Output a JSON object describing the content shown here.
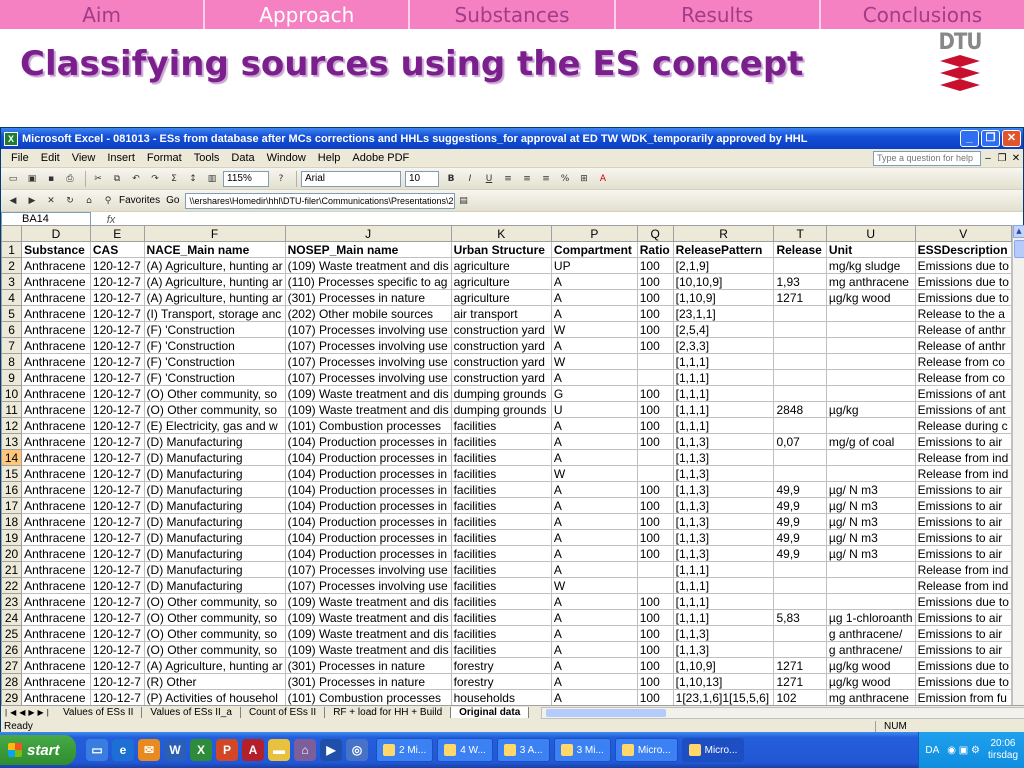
{
  "slide": {
    "nav": [
      {
        "label": "Aim",
        "active": false
      },
      {
        "label": "Approach",
        "active": true
      },
      {
        "label": "Substances",
        "active": false
      },
      {
        "label": "Results",
        "active": false
      },
      {
        "label": "Conclusions",
        "active": false
      }
    ],
    "title": "Classifying sources using the ES concept",
    "logo_text": "DTU"
  },
  "excel": {
    "window_title": "Microsoft Excel - 081013 - ESs from database after MCs corrections and HHLs suggestions_for approval at ED TW WDK_temporarily approved by HHL",
    "menu": [
      "File",
      "Edit",
      "View",
      "Insert",
      "Format",
      "Tools",
      "Data",
      "Window",
      "Help",
      "Adobe PDF"
    ],
    "help_placeholder": "Type a question for help",
    "zoom": "115%",
    "font_name": "Arial",
    "font_size": "10",
    "favorites_label": "Favorites",
    "go_label": "Go",
    "address": "\\\\ershares\\Homedir\\hhl\\DTU-filer\\Communications\\Presentations\\20",
    "name_box": "BA14",
    "fx_label": "fx",
    "column_letters": [
      "D",
      "E",
      "F",
      "J",
      "K",
      "P",
      "Q",
      "R",
      "T",
      "U",
      "V"
    ],
    "header_row": [
      "Substance",
      "CAS",
      "NACE_Main name",
      "NOSEP_Main name",
      "Urban Structure",
      "Compartment",
      "Ratio",
      "ReleasePattern",
      "Release",
      "Unit",
      "ESSDescription"
    ],
    "selected_row": "14",
    "rows": [
      [
        "2",
        "Anthracene",
        "120-12-7",
        "(A) Agriculture, hunting ar",
        "(109) Waste treatment and dis",
        "agriculture",
        "UP",
        "100",
        "[2,1,9]",
        "",
        "mg/kg sludge",
        "Emissions due to"
      ],
      [
        "3",
        "Anthracene",
        "120-12-7",
        "(A) Agriculture, hunting ar",
        "(110) Processes specific to ag",
        "agriculture",
        "A",
        "100",
        "[10,10,9]",
        "1,93",
        "mg anthracene",
        "Emissions due to"
      ],
      [
        "4",
        "Anthracene",
        "120-12-7",
        "(A) Agriculture, hunting ar",
        "(301) Processes in nature",
        "agriculture",
        "A",
        "100",
        "[1,10,9]",
        "1271",
        "µg/kg wood",
        "Emissions due to"
      ],
      [
        "5",
        "Anthracene",
        "120-12-7",
        "(I) Transport, storage anc",
        "(202) Other mobile sources",
        "air transport",
        "A",
        "100",
        "[23,1,1]",
        "",
        "",
        "Release to the a"
      ],
      [
        "6",
        "Anthracene",
        "120-12-7",
        "(F) 'Construction",
        "(107) Processes involving use",
        "construction yard",
        "W",
        "100",
        "[2,5,4]",
        "",
        "",
        "Release of anthr"
      ],
      [
        "7",
        "Anthracene",
        "120-12-7",
        "(F) 'Construction",
        "(107) Processes involving use",
        "construction yard",
        "A",
        "100",
        "[2,3,3]",
        "",
        "",
        "Release of anthr"
      ],
      [
        "8",
        "Anthracene",
        "120-12-7",
        "(F) 'Construction",
        "(107) Processes involving use",
        "construction yard",
        "W",
        "",
        "[1,1,1]",
        "",
        "",
        "Release from co"
      ],
      [
        "9",
        "Anthracene",
        "120-12-7",
        "(F) 'Construction",
        "(107) Processes involving use",
        "construction yard",
        "A",
        "",
        "[1,1,1]",
        "",
        "",
        "Release from co"
      ],
      [
        "10",
        "Anthracene",
        "120-12-7",
        "(O) Other community, so",
        "(109) Waste treatment and dis",
        "dumping grounds",
        "G",
        "100",
        "[1,1,1]",
        "",
        "",
        "Emissions of ant"
      ],
      [
        "11",
        "Anthracene",
        "120-12-7",
        "(O) Other community, so",
        "(109) Waste treatment and dis",
        "dumping grounds",
        "U",
        "100",
        "[1,1,1]",
        "2848",
        "µg/kg",
        "Emissions of ant"
      ],
      [
        "12",
        "Anthracene",
        "120-12-7",
        "(E) Electricity, gas and w",
        "(101) Combustion processes",
        "facilities",
        "A",
        "100",
        "[1,1,1]",
        "",
        "",
        "Release during c"
      ],
      [
        "13",
        "Anthracene",
        "120-12-7",
        "(D) Manufacturing",
        "(104) Production processes in",
        "facilities",
        "A",
        "100",
        "[1,1,3]",
        "0,07",
        "mg/g of coal",
        "Emissions to air"
      ],
      [
        "14",
        "Anthracene",
        "120-12-7",
        "(D) Manufacturing",
        "(104) Production processes in",
        "facilities",
        "A",
        "",
        "[1,1,3]",
        "",
        "",
        "Release from ind"
      ],
      [
        "15",
        "Anthracene",
        "120-12-7",
        "(D) Manufacturing",
        "(104) Production processes in",
        "facilities",
        "W",
        "",
        "[1,1,3]",
        "",
        "",
        "Release from ind"
      ],
      [
        "16",
        "Anthracene",
        "120-12-7",
        "(D) Manufacturing",
        "(104) Production processes in",
        "facilities",
        "A",
        "100",
        "[1,1,3]",
        "49,9",
        "µg/ N m3",
        "Emissions to air"
      ],
      [
        "17",
        "Anthracene",
        "120-12-7",
        "(D) Manufacturing",
        "(104) Production processes in",
        "facilities",
        "A",
        "100",
        "[1,1,3]",
        "49,9",
        "µg/ N m3",
        "Emissions to air"
      ],
      [
        "18",
        "Anthracene",
        "120-12-7",
        "(D) Manufacturing",
        "(104) Production processes in",
        "facilities",
        "A",
        "100",
        "[1,1,3]",
        "49,9",
        "µg/ N m3",
        "Emissions to air"
      ],
      [
        "19",
        "Anthracene",
        "120-12-7",
        "(D) Manufacturing",
        "(104) Production processes in",
        "facilities",
        "A",
        "100",
        "[1,1,3]",
        "49,9",
        "µg/ N m3",
        "Emissions to air"
      ],
      [
        "20",
        "Anthracene",
        "120-12-7",
        "(D) Manufacturing",
        "(104) Production processes in",
        "facilities",
        "A",
        "100",
        "[1,1,3]",
        "49,9",
        "µg/ N m3",
        "Emissions to air"
      ],
      [
        "21",
        "Anthracene",
        "120-12-7",
        "(D) Manufacturing",
        "(107) Processes involving use",
        "facilities",
        "A",
        "",
        "[1,1,1]",
        "",
        "",
        "Release from ind"
      ],
      [
        "22",
        "Anthracene",
        "120-12-7",
        "(D) Manufacturing",
        "(107) Processes involving use",
        "facilities",
        "W",
        "",
        "[1,1,1]",
        "",
        "",
        "Release from ind"
      ],
      [
        "23",
        "Anthracene",
        "120-12-7",
        "(O) Other community, so",
        "(109) Waste treatment and dis",
        "facilities",
        "A",
        "100",
        "[1,1,1]",
        "",
        "",
        "Emissions due to"
      ],
      [
        "24",
        "Anthracene",
        "120-12-7",
        "(O) Other community, so",
        "(109) Waste treatment and dis",
        "facilities",
        "A",
        "100",
        "[1,1,1]",
        "5,83",
        "µg 1-chloroanth",
        "Emissions to air"
      ],
      [
        "25",
        "Anthracene",
        "120-12-7",
        "(O) Other community, so",
        "(109) Waste treatment and dis",
        "facilities",
        "A",
        "100",
        "[1,1,3]",
        "",
        "g anthracene/",
        "Emissions to air"
      ],
      [
        "26",
        "Anthracene",
        "120-12-7",
        "(O) Other community, so",
        "(109) Waste treatment and dis",
        "facilities",
        "A",
        "100",
        "[1,1,3]",
        "",
        "g anthracene/",
        "Emissions to air"
      ],
      [
        "27",
        "Anthracene",
        "120-12-7",
        "(A) Agriculture, hunting ar",
        "(301) Processes in nature",
        "forestry",
        "A",
        "100",
        "[1,10,9]",
        "1271",
        "µg/kg wood",
        "Emissions due to"
      ],
      [
        "28",
        "Anthracene",
        "120-12-7",
        "(R) Other",
        "(301) Processes in nature",
        "forestry",
        "A",
        "100",
        "[1,10,13]",
        "1271",
        "µg/kg wood",
        "Emissions due to"
      ],
      [
        "29",
        "Anthracene",
        "120-12-7",
        "(P) Activities of househol",
        "(101) Combustion processes",
        "households",
        "A",
        "100",
        "1[23,1,6]1[15,5,6]",
        "102",
        "mg anthracene",
        "Emission from fu"
      ]
    ],
    "sheet_tabs": [
      {
        "label": "Values of ESs II",
        "active": false
      },
      {
        "label": "Values of ESs II_a",
        "active": false
      },
      {
        "label": "Count of ESs II",
        "active": false
      },
      {
        "label": "RF + load for HH + Build",
        "active": false
      },
      {
        "label": "Original data",
        "active": true
      }
    ],
    "status_left": "Ready",
    "status_num": "NUM"
  },
  "taskbar": {
    "start_label": "start",
    "tasks": [
      {
        "label": "2 Mi...",
        "active": false
      },
      {
        "label": "4 W...",
        "active": false
      },
      {
        "label": "3 A...",
        "active": false
      },
      {
        "label": "3 Mi...",
        "active": false
      },
      {
        "label": "Micro...",
        "active": false
      },
      {
        "label": "Micro...",
        "active": true
      }
    ],
    "lang": "DA",
    "clock_time": "20:06",
    "clock_day": "tirsdag"
  },
  "colors": {
    "nav_bg": "#f580c2",
    "title": "#7a1f8c",
    "xp_blue": "#245edb",
    "selected_row": "#ffc77a"
  }
}
